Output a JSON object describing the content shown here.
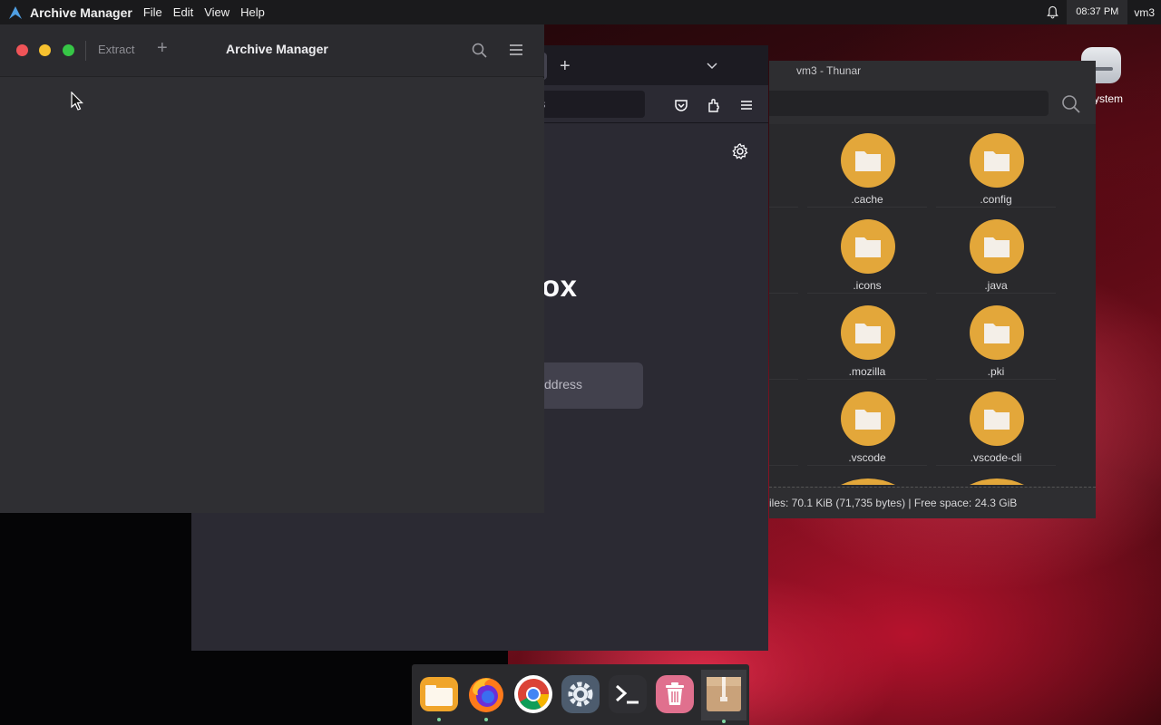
{
  "topbar": {
    "app_name": "Archive Manager",
    "menu": [
      "File",
      "Edit",
      "View",
      "Help"
    ],
    "clock": "08:37 PM",
    "user": "vm3"
  },
  "desktop": {
    "icon_label": "ystem"
  },
  "archive_manager": {
    "title": "Archive Manager",
    "extract_label": "Extract",
    "add_label": "+"
  },
  "firefox": {
    "new_tab_label": "+",
    "url_fragment": "s",
    "brand_fragment": "ox",
    "search_placeholder_fragment": "ddress"
  },
  "thunar": {
    "title": "vm3 - Thunar",
    "items": [
      {
        "name": ".cache"
      },
      {
        "name": ".config"
      },
      {
        "name": ".icons"
      },
      {
        "name": ".java"
      },
      {
        "name": ".mozilla"
      },
      {
        "name": ".pki"
      },
      {
        "name": ".vscode"
      },
      {
        "name": ".vscode-cli"
      }
    ],
    "status": "iles: 70.1 KiB (71,735 bytes)  |  Free space: 24.3 GiB"
  },
  "dock": {
    "items": [
      {
        "name": "Files",
        "icon": "files-icon",
        "running": true
      },
      {
        "name": "Firefox",
        "icon": "firefox-icon",
        "running": true
      },
      {
        "name": "Chrome",
        "icon": "chrome-icon",
        "running": false
      },
      {
        "name": "Settings",
        "icon": "settings-icon",
        "running": false
      },
      {
        "name": "Terminal",
        "icon": "terminal-icon",
        "running": false
      },
      {
        "name": "Trash",
        "icon": "trash-icon",
        "running": false
      },
      {
        "name": "Archive Manager",
        "icon": "archive-icon",
        "running": true
      }
    ]
  },
  "colors": {
    "folder": "#e3a73a",
    "close": "#f05458",
    "minimize": "#f7c12f",
    "maximize": "#36c646"
  }
}
